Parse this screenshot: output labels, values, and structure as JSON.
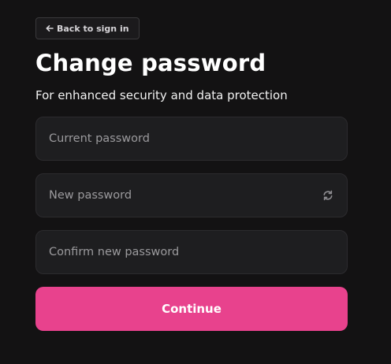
{
  "back_button": {
    "label": "Back to sign in",
    "icon": "arrow-left-icon"
  },
  "heading": {
    "title": "Change password",
    "subtitle": "For enhanced security and data protection"
  },
  "fields": {
    "current": {
      "placeholder": "Current password",
      "value": ""
    },
    "new": {
      "placeholder": "New password",
      "value": "",
      "action_icon": "regenerate-icon"
    },
    "confirm": {
      "placeholder": "Confirm new password",
      "value": ""
    }
  },
  "continue_button": {
    "label": "Continue"
  },
  "colors": {
    "background": "#131213",
    "field_background": "#1e1e20",
    "accent": "#e8428d"
  }
}
